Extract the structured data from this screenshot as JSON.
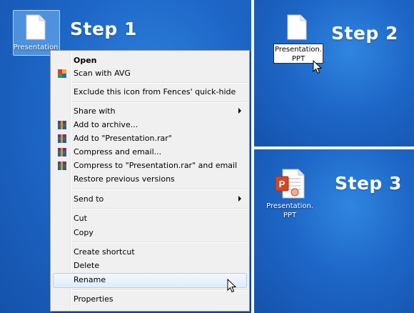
{
  "steps": {
    "step1": "Step 1",
    "step2": "Step 2",
    "step3": "Step 3"
  },
  "desktop": {
    "step1_icon_caption": "Presentation",
    "step2_rename_value": "Presentation.\nPPT",
    "step3_icon_caption": "Presentation.\nPPT"
  },
  "context_menu": {
    "items": [
      {
        "label": "Open",
        "icon": "none"
      },
      {
        "label": "Scan with AVG",
        "icon": "avg-icon"
      },
      {
        "label": "Exclude this icon from Fences' quick-hide",
        "icon": "none"
      },
      {
        "label": "Share with",
        "icon": "none",
        "submenu": true
      },
      {
        "label": "Add to archive...",
        "icon": "winrar-icon"
      },
      {
        "label": "Add to \"Presentation.rar\"",
        "icon": "winrar-icon"
      },
      {
        "label": "Compress and email...",
        "icon": "winrar-icon"
      },
      {
        "label": "Compress to \"Presentation.rar\" and email",
        "icon": "winrar-icon"
      },
      {
        "label": "Restore previous versions",
        "icon": "none"
      },
      {
        "label": "Send to",
        "icon": "none",
        "submenu": true
      },
      {
        "label": "Cut",
        "icon": "none"
      },
      {
        "label": "Copy",
        "icon": "none"
      },
      {
        "label": "Create shortcut",
        "icon": "none"
      },
      {
        "label": "Delete",
        "icon": "none"
      },
      {
        "label": "Rename",
        "icon": "none",
        "highlighted": true
      },
      {
        "label": "Properties",
        "icon": "none"
      }
    ]
  },
  "colors": {
    "desktop_blue": "#1e67c8",
    "menu_background": "#f0f0f0",
    "menu_hover": "#e0ecfb"
  }
}
